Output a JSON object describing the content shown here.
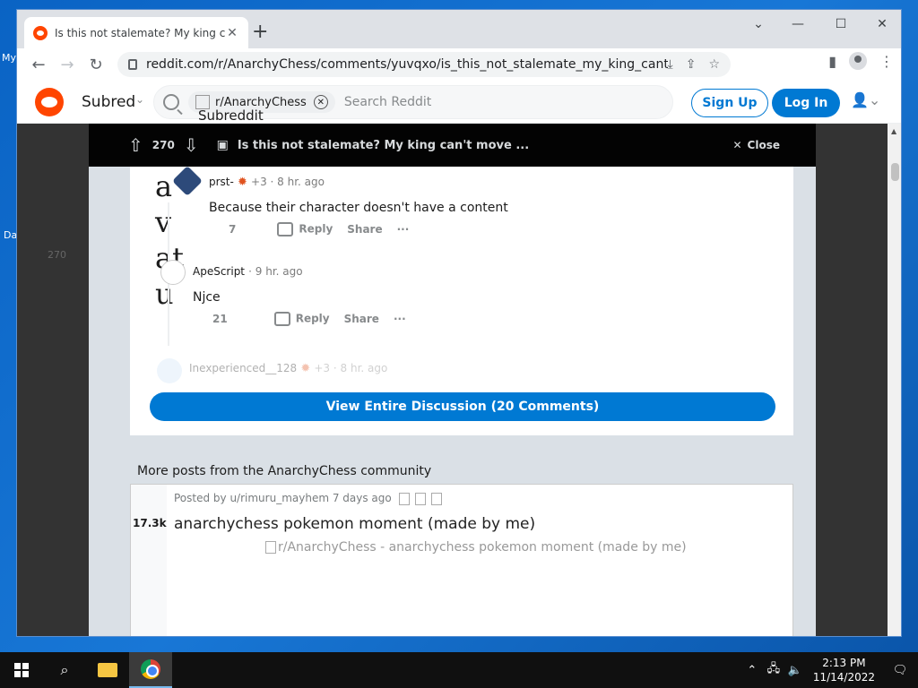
{
  "desktop": {
    "frag_top": "My",
    "frag_mid": "Da"
  },
  "browser": {
    "tab_title": "Is this not stalemate? My king ca",
    "url": "reddit.com/r/AnarchyChess/comments/yuvqxo/is_this_not_stalemate_my_king_cant_move_but_isnt/"
  },
  "reddit": {
    "subreddit_broken": "Subred",
    "subreddit_broken2": "Subreddit",
    "search_chip": "r/AnarchyChess",
    "search_placeholder": "Search Reddit",
    "signup": "Sign Up",
    "login": "Log In"
  },
  "modal": {
    "score": "270",
    "title": "Is this not stalemate? My king can't move ...",
    "close": "Close",
    "left_score": "270"
  },
  "comments": [
    {
      "user": "prst-",
      "flair": "+3 · 8 hr. ago",
      "body": "Because their character doesn't have a content",
      "votes": "7",
      "reply": "Reply",
      "share": "Share"
    },
    {
      "user": "ApeScript",
      "flair": "· 9 hr. ago",
      "body": "Njce",
      "votes": "21",
      "reply": "Reply",
      "share": "Share"
    },
    {
      "user": "Inexperienced__128",
      "flair": "+3 · 8 hr. ago"
    }
  ],
  "broken_letters": "a\nv\nat\nu",
  "view_all": "View Entire Discussion (20 Comments)",
  "more_posts_title": "More posts from the AnarchyChess community",
  "post": {
    "meta": "Posted by u/rimuru_mayhem 7 days ago",
    "score": "17.3k",
    "title": "anarchychess pokemon moment (made by me)",
    "img_alt": "r/AnarchyChess - anarchychess pokemon moment (made by me)"
  },
  "taskbar": {
    "time": "2:13 PM",
    "date": "11/14/2022"
  }
}
